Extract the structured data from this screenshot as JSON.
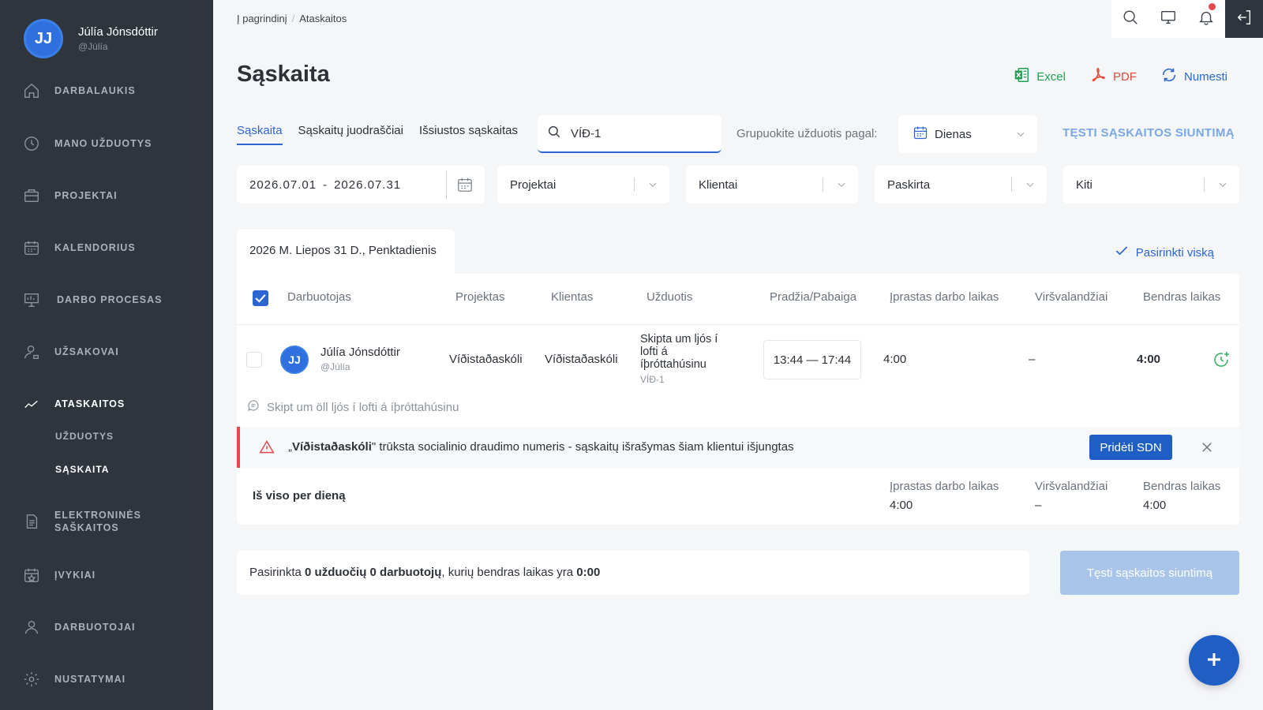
{
  "user": {
    "initials": "JJ",
    "name": "Júlía Jónsdóttir",
    "handle": "@Júlía"
  },
  "sidebar": {
    "items": [
      {
        "label": "DARBALAUKIS",
        "icon": "home-icon"
      },
      {
        "label": "MANO UŽDUOTYS",
        "icon": "clock-icon"
      },
      {
        "label": "PROJEKTAI",
        "icon": "briefcase-icon"
      },
      {
        "label": "KALENDORIUS",
        "icon": "calendar-icon"
      },
      {
        "label": "DARBO PROCESAS",
        "icon": "presentation-icon"
      },
      {
        "label": "UŽSAKOVAI",
        "icon": "client-icon"
      },
      {
        "label": "ATASKAITOS",
        "icon": "chart-line-icon"
      },
      {
        "label": "ELEKTRONINĖS SAŠKAITOS",
        "icon": "document-icon"
      },
      {
        "label": "ĮVYKIAI",
        "icon": "event-calendar-icon"
      },
      {
        "label": "DARBUOTOJAI",
        "icon": "employees-icon"
      },
      {
        "label": "NUSTATYMAI",
        "icon": "gear-icon"
      }
    ],
    "subitems": [
      "UŽDUOTYS",
      "SĄSKAITA"
    ]
  },
  "breadcrumb": {
    "home": "Į pagrindinį",
    "separator": "/",
    "current": "Ataskaitos"
  },
  "page": {
    "title": "Sąskaita"
  },
  "actions": {
    "excel": "Excel",
    "pdf": "PDF",
    "reset": "Numesti"
  },
  "tabs": [
    "Sąskaita",
    "Sąskaitų juodraščiai",
    "Išsiustos sąskaitas"
  ],
  "search": {
    "value": "VÍÐ-1"
  },
  "group": {
    "label": "Grupuokite užduotis pagal:",
    "value": "Dienas"
  },
  "continue_link": "TĘSTI SĄSKAITOS SIUNTIMĄ",
  "filters": {
    "date_from": "2026.07.01",
    "date_sep": "-",
    "date_to": "2026.07.31",
    "projects": "Projektai",
    "clients": "Klientai",
    "assigned": "Paskirta",
    "other": "Kiti"
  },
  "day": {
    "label": "2026 M. Liepos 31 D., Penktadienis"
  },
  "select_all": "Pasirinkti viską",
  "table": {
    "headers": {
      "employee": "Darbuotojas",
      "project": "Projektas",
      "client": "Klientas",
      "task": "Užduotis",
      "start_end": "Pradžia/Pabaiga",
      "regular": "Įprastas darbo laikas",
      "overtime": "Viršvalandžiai",
      "total": "Bendras laikas"
    },
    "row": {
      "initials": "JJ",
      "name": "Júlía Jónsdóttir",
      "handle": "@Júlía",
      "project": "Víðistaðaskóli",
      "client": "Víðistaðaskóli",
      "task": "Skipta um ljós í lofti á íþróttahúsinu",
      "task_code": "VÍÐ-1",
      "time": "13:44 — 17:44",
      "regular": "4:00",
      "overtime": "–",
      "total": "4:00",
      "comment": "Skipt um öll ljós í lofti á íþróttahúsinu"
    }
  },
  "warning": {
    "open_quote": "„",
    "client": "Víðistaðaskóli",
    "text": "\" trūksta socialinio draudimo numeris - sąskaitų išrašymas šiam klientui išjungtas",
    "button": "Pridėti SDN"
  },
  "day_totals": {
    "label": "Iš viso per dieną",
    "regular_label": "Įprastas darbo laikas",
    "regular": "4:00",
    "overtime_label": "Viršvalandžiai",
    "overtime": "–",
    "total_label": "Bendras laikas",
    "total": "4:00"
  },
  "summary": {
    "prefix": "Pasirinkta ",
    "tasks": "0 užduočių",
    "space": " ",
    "employees": "0 darbuotojų",
    "middle": ", kurių bendras laikas yra ",
    "time": "0:00",
    "button": "Tęsti sąskaitos siuntimą"
  },
  "colors": {
    "accent": "#2b66d1",
    "sidebar": "#2e353d",
    "danger": "#e5484d",
    "success": "#3bb36a"
  }
}
